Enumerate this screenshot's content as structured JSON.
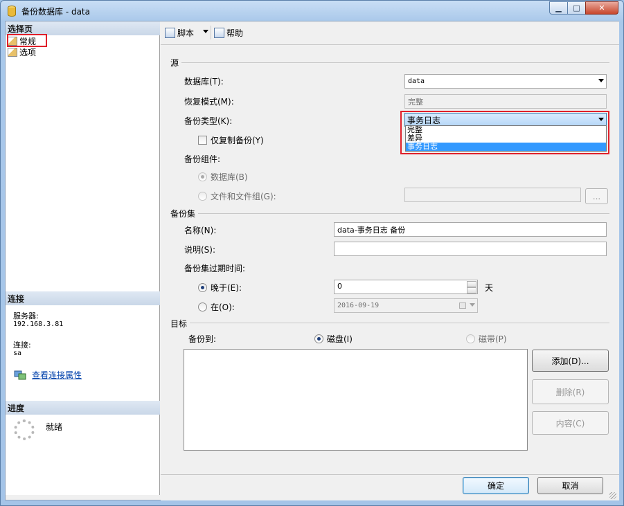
{
  "window": {
    "title": "备份数据库 - data"
  },
  "left": {
    "select_page_header": "选择页",
    "pages": [
      "常规",
      "选项"
    ],
    "connection_header": "连接",
    "server_label": "服务器:",
    "server_value": "192.168.3.81",
    "connection_label": "连接:",
    "connection_value": "sa",
    "view_conn_props": "查看连接属性",
    "progress_header": "进度",
    "progress_status": "就绪"
  },
  "toolbar": {
    "script_label": "脚本",
    "help_label": "帮助"
  },
  "source": {
    "group_label": "源",
    "database_label": "数据库(T):",
    "database_value": "data",
    "recovery_label": "恢复模式(M):",
    "recovery_value": "完整",
    "backup_type_label": "备份类型(K):",
    "backup_type_value": "事务日志",
    "backup_type_options": [
      "完整",
      "差异",
      "事务日志"
    ],
    "copy_only_label": "仅复制备份(Y)",
    "component_label": "备份组件:",
    "comp_database": "数据库(B)",
    "comp_files": "文件和文件组(G):",
    "files_browse": "..."
  },
  "backup_set": {
    "group_label": "备份集",
    "name_label": "名称(N):",
    "name_value": "data-事务日志  备份",
    "desc_label": "说明(S):",
    "desc_value": "",
    "expire_label": "备份集过期时间:",
    "after_label": "晚于(E):",
    "after_value": "0",
    "days_label": "天",
    "on_label": "在(O):",
    "on_value": "2016-09-19"
  },
  "destination": {
    "group_label": "目标",
    "backup_to_label": "备份到:",
    "disk_label": "磁盘(I)",
    "tape_label": "磁带(P)",
    "add_button": "添加(D)...",
    "remove_button": "删除(R)",
    "contents_button": "内容(C)"
  },
  "footer": {
    "ok_button": "确定",
    "cancel_button": "取消"
  },
  "colors": {
    "highlight_box": "#e0202a",
    "selected_option": "#3399ff",
    "link": "#0645ad"
  }
}
